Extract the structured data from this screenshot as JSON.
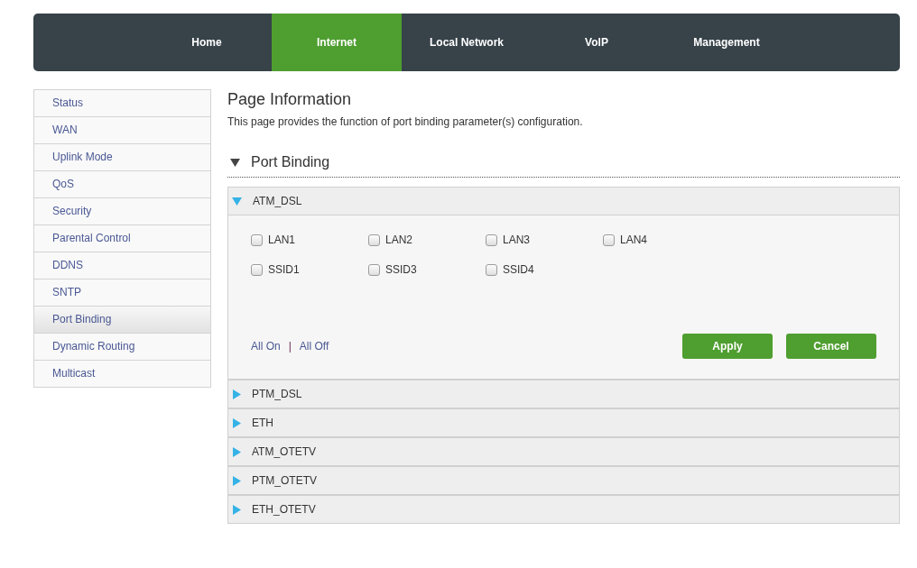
{
  "nav": {
    "tabs": [
      {
        "label": "Home",
        "selected": false
      },
      {
        "label": "Internet",
        "selected": true
      },
      {
        "label": "Local Network",
        "selected": false
      },
      {
        "label": "VoIP",
        "selected": false
      },
      {
        "label": "Management",
        "selected": false
      }
    ]
  },
  "sidebar": {
    "items": [
      {
        "label": "Status",
        "selected": false
      },
      {
        "label": "WAN",
        "selected": false
      },
      {
        "label": "Uplink Mode",
        "selected": false
      },
      {
        "label": "QoS",
        "selected": false
      },
      {
        "label": "Security",
        "selected": false
      },
      {
        "label": "Parental Control",
        "selected": false
      },
      {
        "label": "DDNS",
        "selected": false
      },
      {
        "label": "SNTP",
        "selected": false
      },
      {
        "label": "Port Binding",
        "selected": true
      },
      {
        "label": "Dynamic Routing",
        "selected": false
      },
      {
        "label": "Multicast",
        "selected": false
      }
    ]
  },
  "page_info": {
    "title": "Page Information",
    "description": "This page provides the function of port binding parameter(s) configuration."
  },
  "section": {
    "title": "Port Binding",
    "expanded": true
  },
  "groups": [
    {
      "label": "ATM_DSL",
      "expanded": true,
      "options": [
        {
          "label": "LAN1",
          "checked": false
        },
        {
          "label": "LAN2",
          "checked": false
        },
        {
          "label": "LAN3",
          "checked": false
        },
        {
          "label": "LAN4",
          "checked": false
        },
        {
          "label": "SSID1",
          "checked": false
        },
        {
          "label": "SSID3",
          "checked": false
        },
        {
          "label": "SSID4",
          "checked": false
        }
      ],
      "links": [
        "All On",
        "All Off"
      ],
      "separator": "|",
      "buttons": [
        "Apply",
        "Cancel"
      ]
    },
    {
      "label": "PTM_DSL",
      "expanded": false
    },
    {
      "label": "ETH",
      "expanded": false
    },
    {
      "label": "ATM_OTETV",
      "expanded": false
    },
    {
      "label": "PTM_OTETV",
      "expanded": false
    },
    {
      "label": "ETH_OTETV",
      "expanded": false
    }
  ]
}
